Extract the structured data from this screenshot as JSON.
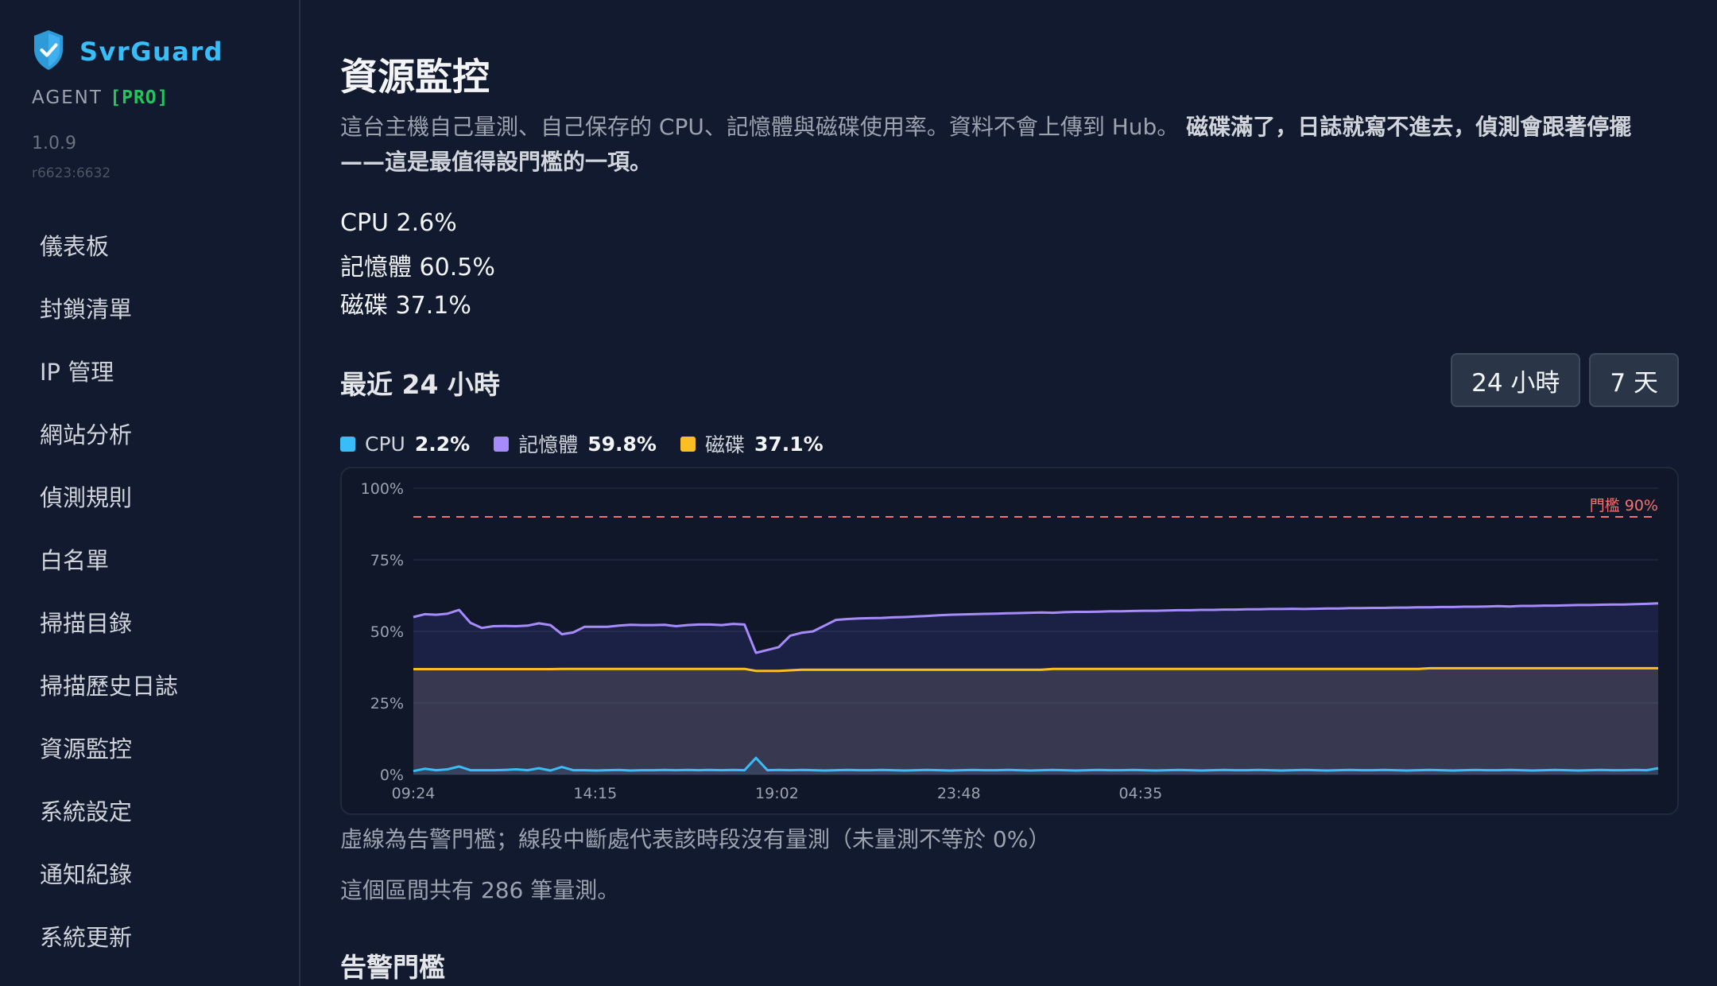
{
  "sidebar": {
    "brand": "SvrGuard",
    "agent_label": "AGENT",
    "agent_tier": "[PRO]",
    "version": "1.0.9",
    "build": "r6623:6632",
    "items": [
      {
        "label": "儀表板"
      },
      {
        "label": "封鎖清單"
      },
      {
        "label": "IP 管理"
      },
      {
        "label": "網站分析"
      },
      {
        "label": "偵測規則"
      },
      {
        "label": "白名單"
      },
      {
        "label": "掃描目錄"
      },
      {
        "label": "掃描歷史日誌"
      },
      {
        "label": "資源監控"
      },
      {
        "label": "系統設定"
      },
      {
        "label": "通知紀錄"
      },
      {
        "label": "系統更新"
      }
    ]
  },
  "main": {
    "title": "資源監控",
    "description": "這台主機自己量測、自己保存的 CPU、記憶體與磁碟使用率。資料不會上傳到 Hub。",
    "description_bold": "磁碟滿了，日誌就寫不進去，偵測會跟著停擺——這是最值得設門檻的一項。",
    "stats": {
      "cpu": "CPU 2.6%",
      "memory": "記憶體 60.5%",
      "disk": "磁碟 37.1%"
    },
    "section_title": "最近 24 小時",
    "range_buttons": [
      "24 小時",
      "7 天"
    ],
    "legend": [
      {
        "name": "CPU",
        "value": "2.2%",
        "color": "#38bdf8"
      },
      {
        "name": "記憶體",
        "value": "59.8%",
        "color": "#a78bfa"
      },
      {
        "name": "磁碟",
        "value": "37.1%",
        "color": "#fbbf24"
      }
    ],
    "note_dashed": "虛線為告警門檻；線段中斷處代表該時段沒有量測（未量測不等於 0%）",
    "note_count": "這個區間共有 286 筆量測。",
    "subhead": "告警門檻"
  },
  "chart_data": {
    "type": "line",
    "x_tick_labels": [
      "09:24",
      "14:15",
      "19:02",
      "23:48",
      "04:35"
    ],
    "y_tick_labels": [
      "100%",
      "75%",
      "50%",
      "25%",
      "0%"
    ],
    "ylim": [
      0,
      100
    ],
    "threshold": {
      "value": 90,
      "label": "門檻 90%",
      "color": "#f87171"
    },
    "series": [
      {
        "name": "記憶體",
        "color": "#a78bfa",
        "values": [
          55.0,
          56.0,
          55.8,
          56.2,
          57.5,
          53.0,
          51.2,
          51.8,
          51.9,
          51.8,
          52.0,
          52.8,
          52.2,
          49.0,
          49.6,
          51.6,
          51.6,
          51.6,
          52.0,
          52.3,
          52.2,
          52.2,
          52.3,
          51.8,
          52.2,
          52.4,
          52.4,
          52.2,
          52.6,
          52.4,
          42.5,
          43.5,
          44.5,
          48.5,
          49.5,
          50.0,
          52.0,
          54.0,
          54.3,
          54.5,
          54.6,
          54.7,
          54.9,
          55.0,
          55.2,
          55.4,
          55.6,
          55.8,
          55.9,
          56.0,
          56.1,
          56.2,
          56.3,
          56.4,
          56.5,
          56.6,
          56.5,
          56.7,
          56.8,
          56.8,
          56.9,
          57.0,
          57.0,
          57.1,
          57.2,
          57.2,
          57.3,
          57.4,
          57.4,
          57.5,
          57.5,
          57.6,
          57.6,
          57.7,
          57.7,
          57.8,
          57.8,
          57.9,
          57.8,
          57.9,
          58.0,
          58.0,
          58.1,
          58.1,
          58.2,
          58.2,
          58.3,
          58.3,
          58.4,
          58.4,
          58.5,
          58.5,
          58.6,
          58.6,
          58.7,
          58.8,
          58.7,
          58.9,
          58.9,
          59.0,
          59.0,
          59.1,
          59.2,
          59.2,
          59.3,
          59.4,
          59.4,
          59.5,
          59.6,
          59.8
        ],
        "gaps": []
      },
      {
        "name": "磁碟",
        "color": "#fbbf24",
        "values": [
          36.8,
          36.8,
          36.8,
          36.8,
          36.8,
          36.8,
          36.8,
          36.8,
          36.8,
          36.8,
          36.8,
          36.8,
          36.8,
          36.9,
          36.9,
          36.9,
          36.9,
          36.9,
          36.9,
          36.9,
          36.9,
          36.9,
          36.9,
          36.9,
          36.9,
          36.9,
          36.9,
          36.9,
          36.9,
          36.9,
          36.2,
          36.2,
          36.2,
          36.4,
          36.6,
          36.6,
          36.6,
          36.6,
          36.6,
          36.6,
          36.6,
          36.6,
          36.6,
          36.6,
          36.6,
          36.6,
          36.6,
          36.6,
          36.6,
          36.6,
          36.6,
          36.6,
          36.6,
          36.6,
          36.6,
          36.6,
          36.9,
          36.9,
          36.9,
          36.9,
          36.9,
          36.9,
          36.9,
          36.9,
          36.9,
          36.9,
          36.9,
          36.9,
          36.9,
          36.9,
          36.9,
          36.9,
          36.9,
          36.9,
          36.9,
          36.9,
          36.9,
          36.9,
          36.9,
          36.9,
          36.9,
          36.9,
          36.9,
          36.9,
          36.9,
          36.9,
          36.9,
          36.9,
          36.9,
          37.1,
          37.1,
          37.1,
          37.1,
          37.1,
          37.1,
          37.1,
          37.1,
          37.1,
          37.1,
          37.1,
          37.1,
          37.1,
          37.1,
          37.1,
          37.1,
          37.1,
          37.1,
          37.1,
          37.1,
          37.1
        ]
      },
      {
        "name": "CPU",
        "color": "#38bdf8",
        "values": [
          1.2,
          2.0,
          1.5,
          1.8,
          2.8,
          1.5,
          1.5,
          1.5,
          1.6,
          1.8,
          1.5,
          2.2,
          1.4,
          2.6,
          1.5,
          1.5,
          1.4,
          1.5,
          1.6,
          1.4,
          1.5,
          1.5,
          1.6,
          1.5,
          1.6,
          1.5,
          1.6,
          1.5,
          1.6,
          1.5,
          5.8,
          1.5,
          1.6,
          1.5,
          1.6,
          1.5,
          1.4,
          1.5,
          1.6,
          1.5,
          1.5,
          1.6,
          1.5,
          1.4,
          1.5,
          1.6,
          1.5,
          1.4,
          1.5,
          1.6,
          1.5,
          1.5,
          1.6,
          1.5,
          1.4,
          1.5,
          1.6,
          1.5,
          1.4,
          1.5,
          1.6,
          1.5,
          1.5,
          1.6,
          1.5,
          1.4,
          1.5,
          1.6,
          1.5,
          1.4,
          1.5,
          1.6,
          1.5,
          1.5,
          1.6,
          1.5,
          1.4,
          1.5,
          1.6,
          1.5,
          1.4,
          1.5,
          1.6,
          1.5,
          1.5,
          1.6,
          1.5,
          1.4,
          1.5,
          1.6,
          1.5,
          1.4,
          1.5,
          1.6,
          1.5,
          1.5,
          1.6,
          1.5,
          1.4,
          1.5,
          1.6,
          1.5,
          1.4,
          1.5,
          1.6,
          1.5,
          1.5,
          1.6,
          1.5,
          2.2
        ]
      }
    ],
    "grid": true
  }
}
